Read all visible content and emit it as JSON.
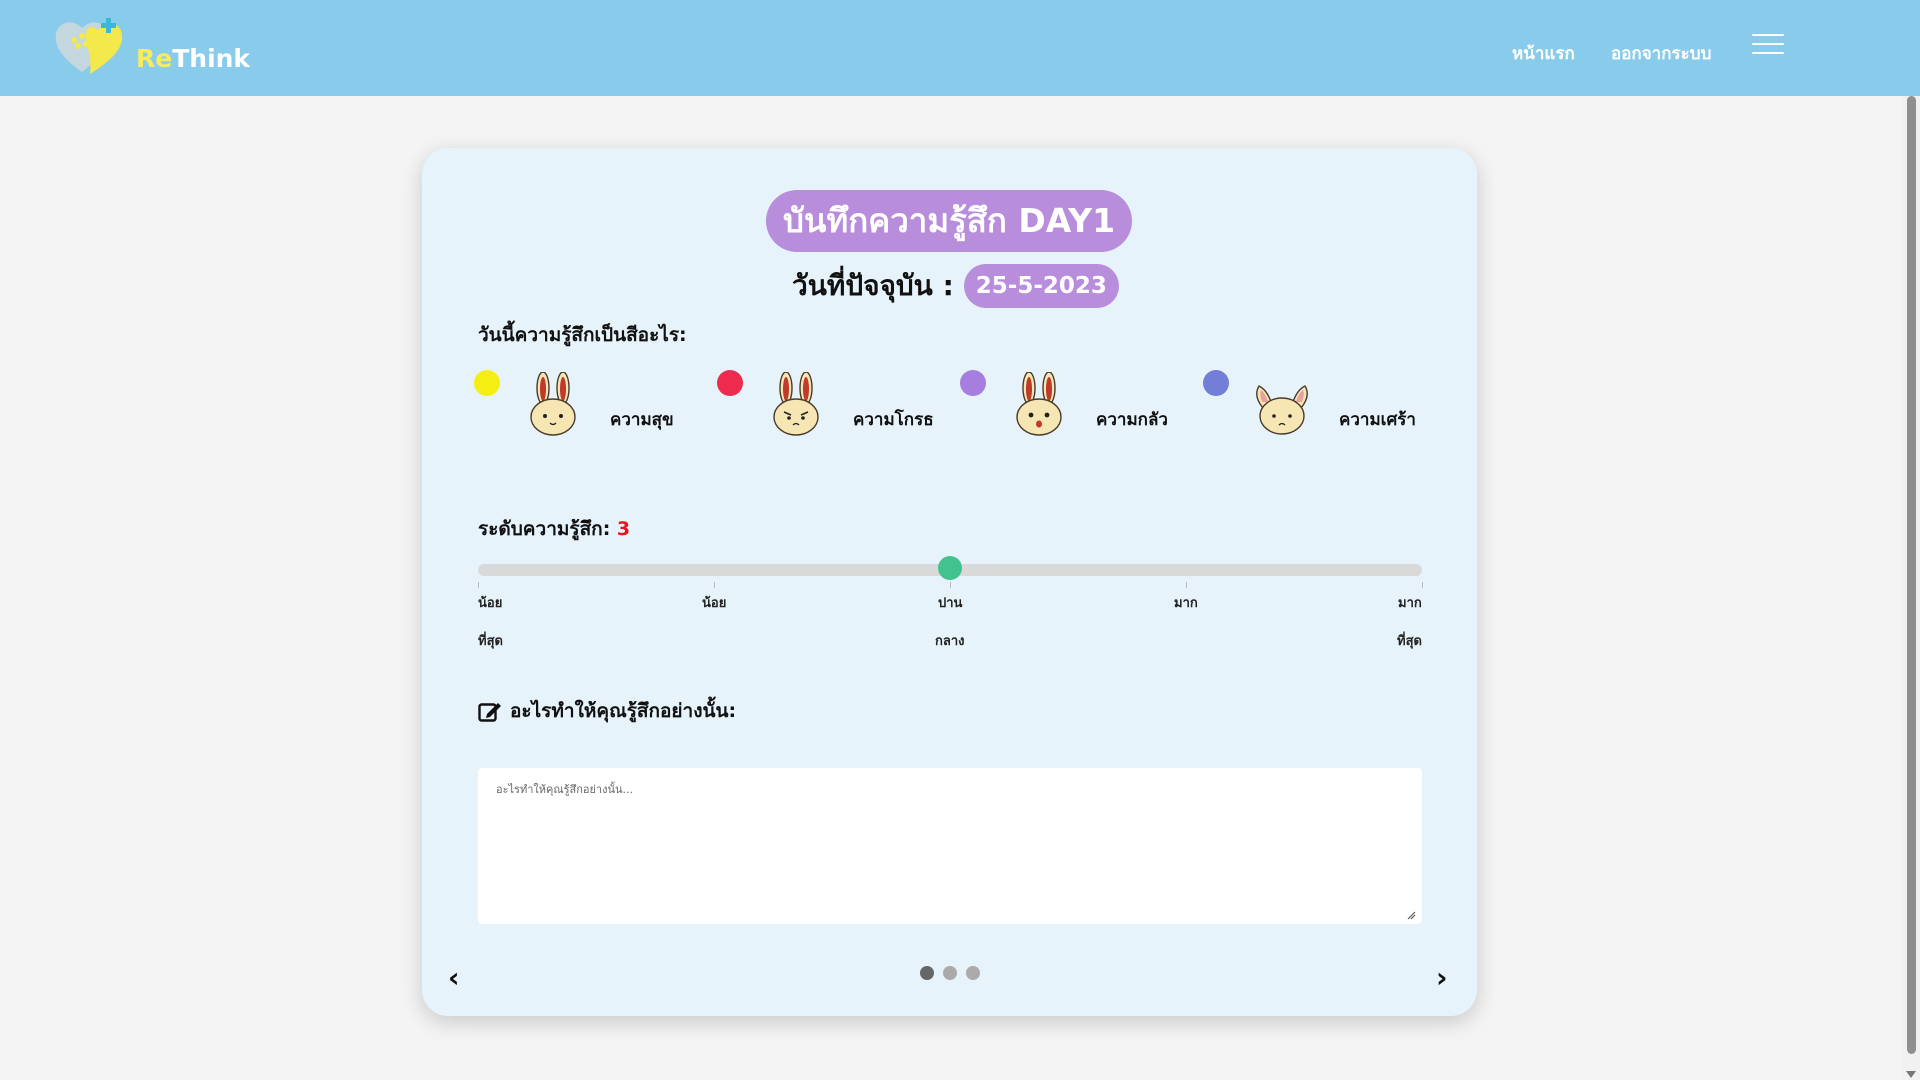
{
  "header": {
    "logo_text_re": "Re",
    "logo_text_think": "Think",
    "nav_home": "หน้าแรก",
    "nav_logout": "ออกจากระบบ",
    "background_color": "#89cbeb"
  },
  "card": {
    "title": "บันทึกความรู้สึก DAY1",
    "date_label": "วันที่ปัจจุบัน :",
    "date_value": "25-5-2023",
    "question": "วันนี้ความรู้สึกเป็นสีอะไร:",
    "moods": [
      {
        "label": "ความสุข",
        "color": "#f5ee12",
        "icon": "bunny-happy-icon"
      },
      {
        "label": "ความโกรธ",
        "color": "#ee2a4e",
        "icon": "bunny-angry-icon"
      },
      {
        "label": "ความกลัว",
        "color": "#a57ee0",
        "icon": "bunny-scared-icon"
      },
      {
        "label": "ความเศร้า",
        "color": "#737fd7",
        "icon": "bunny-sad-icon"
      }
    ],
    "level_label": "ระดับความรู้สึก:",
    "level_value": "3",
    "level_fraction": 0.5,
    "scale": [
      {
        "line1": "น้อย",
        "line2": "ที่สุด"
      },
      {
        "line1": "น้อย",
        "line2": ""
      },
      {
        "line1": "ปาน",
        "line2": "กลาง"
      },
      {
        "line1": "มาก",
        "line2": ""
      },
      {
        "line1": "มาก",
        "line2": "ที่สุด"
      }
    ],
    "reason_label": "อะไรทำให้คุณรู้สึกอย่างนั้น:",
    "reason_placeholder": "อะไรทำให้คุณรู้สึกอย่างนั้น...",
    "reason_value": "",
    "prev_arrow": "‹",
    "next_arrow": "›",
    "slide_count": 3,
    "active_slide": 1
  }
}
